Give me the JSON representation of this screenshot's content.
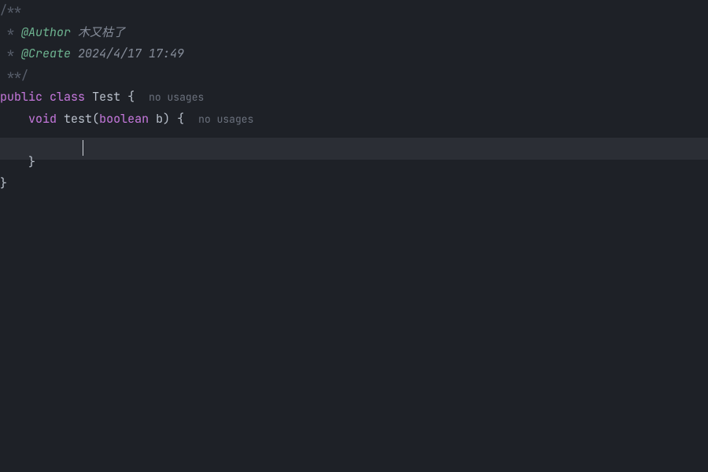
{
  "doc": {
    "open": "/**",
    "star": " * ",
    "starend": " **/",
    "author_tag": "@Author",
    "author_val": " 木又枯了",
    "create_tag": "@Create",
    "create_val": " 2024/4/17 17:49"
  },
  "code": {
    "kw_public": "public",
    "kw_class": "class",
    "class_name": "Test",
    "brace_open": "{",
    "brace_close": "}",
    "indent1": "    ",
    "indent2": "        ",
    "kw_void": "void",
    "method": "test",
    "lparen": "(",
    "rparen": ")",
    "kw_boolean": "boolean",
    "param": "b",
    "space": " "
  },
  "hints": {
    "no_usages": "no usages"
  }
}
